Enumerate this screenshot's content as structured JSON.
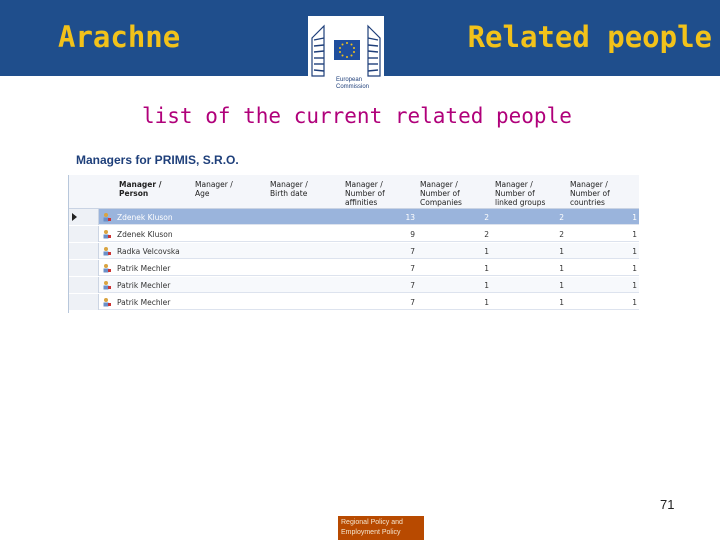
{
  "header": {
    "left_title": "Arachne",
    "right_title": "Related people",
    "logo_text_line1": "European",
    "logo_text_line2": "Commission"
  },
  "subtitle": "list of the current related people",
  "grid": {
    "title": "Managers for PRIMIS, S.R.O.",
    "columns": [
      {
        "line1": "Manager /",
        "line2": "Person",
        "line3": ""
      },
      {
        "line1": "Manager /",
        "line2": "Age",
        "line3": ""
      },
      {
        "line1": "Manager /",
        "line2": "Birth date",
        "line3": ""
      },
      {
        "line1": "Manager /",
        "line2": "Number of",
        "line3": "affinities"
      },
      {
        "line1": "Manager /",
        "line2": "Number of",
        "line3": "Companies"
      },
      {
        "line1": "Manager /",
        "line2": "Number of",
        "line3": "linked groups"
      },
      {
        "line1": "Manager /",
        "line2": "Number of",
        "line3": "countries"
      }
    ],
    "rows": [
      {
        "person": "Zdenek Kluson",
        "affinities": "13",
        "companies": "2",
        "groups": "2",
        "countries": "1"
      },
      {
        "person": "Zdenek Kluson",
        "affinities": "9",
        "companies": "2",
        "groups": "2",
        "countries": "1"
      },
      {
        "person": "Radka Velcovska",
        "affinities": "7",
        "companies": "1",
        "groups": "1",
        "countries": "1"
      },
      {
        "person": "Patrik Mechler",
        "affinities": "7",
        "companies": "1",
        "groups": "1",
        "countries": "1"
      },
      {
        "person": "Patrik Mechler",
        "affinities": "7",
        "companies": "1",
        "groups": "1",
        "countries": "1"
      },
      {
        "person": "Patrik Mechler",
        "affinities": "7",
        "companies": "1",
        "groups": "1",
        "countries": "1"
      }
    ],
    "selected_row": 0
  },
  "page_number": "71",
  "footer": {
    "line1": "Regional Policy and",
    "line2": "Employment Policy"
  },
  "colors": {
    "header_bg": "#1f4e8c",
    "title_yellow": "#f2c21a",
    "subtitle_magenta": "#b0007a",
    "selected_row": "#9ab4dc",
    "footer_bg": "#b84a00"
  }
}
